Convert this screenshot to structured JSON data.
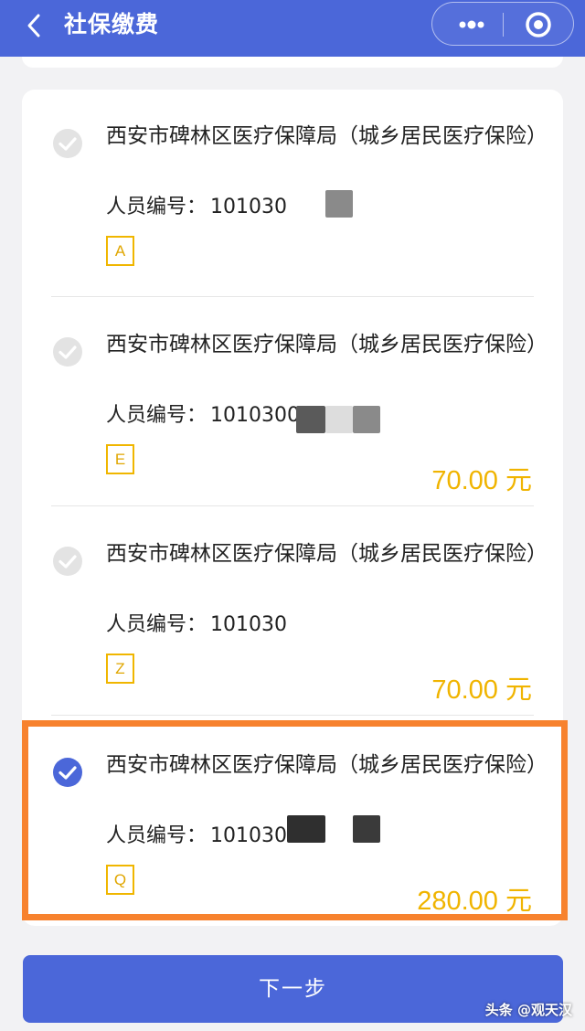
{
  "header": {
    "title": "社保缴费",
    "back_icon": "chevron-left-icon",
    "more_icon": "more-dots-icon",
    "close_icon": "target-circle-icon",
    "bg_color": "#4b67d9"
  },
  "items": [
    {
      "name": "西安市碑林区医疗保障局（城乡居民医疗保险）",
      "person_label": "人员编号：",
      "person_id": "101030",
      "tag": "A",
      "amount": "",
      "selected": false
    },
    {
      "name": "西安市碑林区医疗保障局（城乡居民医疗保险）",
      "person_label": "人员编号：",
      "person_id": "10103000",
      "tag": "E",
      "amount": "70.00 元",
      "selected": false
    },
    {
      "name": "西安市碑林区医疗保障局（城乡居民医疗保险）",
      "person_label": "人员编号：",
      "person_id": "101030",
      "tag": "Z",
      "amount": "70.00 元",
      "selected": false
    },
    {
      "name": "西安市碑林区医疗保障局（城乡居民医疗保险）",
      "person_label": "人员编号：",
      "person_id": "101030",
      "tag": "Q",
      "amount": "280.00 元",
      "selected": true
    }
  ],
  "next_button": "下一步",
  "watermark": "头条 @观天汉",
  "colors": {
    "accent": "#4b67d9",
    "amount": "#f0b400",
    "highlight": "#f7822e",
    "check_inactive": "#e3e3e3"
  }
}
